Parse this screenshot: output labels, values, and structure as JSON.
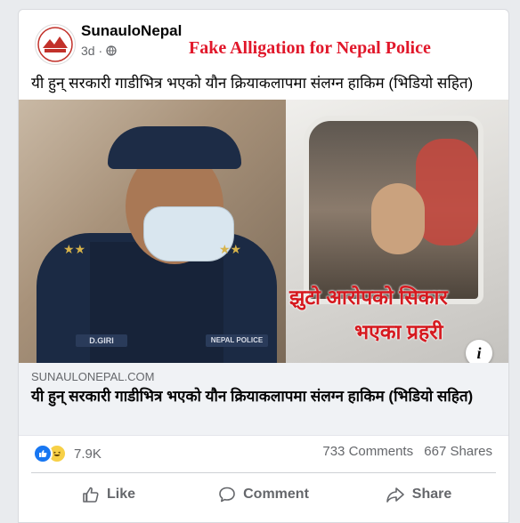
{
  "post": {
    "page_name": "SunauloNepal",
    "time": "3d",
    "privacy_separator": "·",
    "overlay_title": "Fake Alligation for Nepal Police",
    "text": "यी हुन् सरकारी गाडीभित्र भएको यौन क्रियाकलापमा संलग्न हाकिम (भिडियो सहित)"
  },
  "media": {
    "overlay_line1": "झुटो आरोपको सिकार",
    "overlay_line2": "भएका प्रहरी",
    "badge_left": "D.GIRI",
    "badge_right": "NEPAL POLICE",
    "info_symbol": "i"
  },
  "link": {
    "domain": "SUNAULONEPAL.COM",
    "title": "यी हुन् सरकारी गाडीभित्र भएको यौन क्रियाकलापमा संलग्न हाकिम (भिडियो सहित)"
  },
  "stats": {
    "reactions_count": "7.9K",
    "comments": "733 Comments",
    "shares": "667 Shares"
  },
  "actions": {
    "like": "Like",
    "comment": "Comment",
    "share": "Share"
  },
  "colors": {
    "overlay_red": "#e1172a",
    "facebook_blue": "#1877f2"
  },
  "icons": [
    "globe-icon",
    "like-icon",
    "haha-icon",
    "comment-icon",
    "share-icon",
    "info-icon"
  ]
}
